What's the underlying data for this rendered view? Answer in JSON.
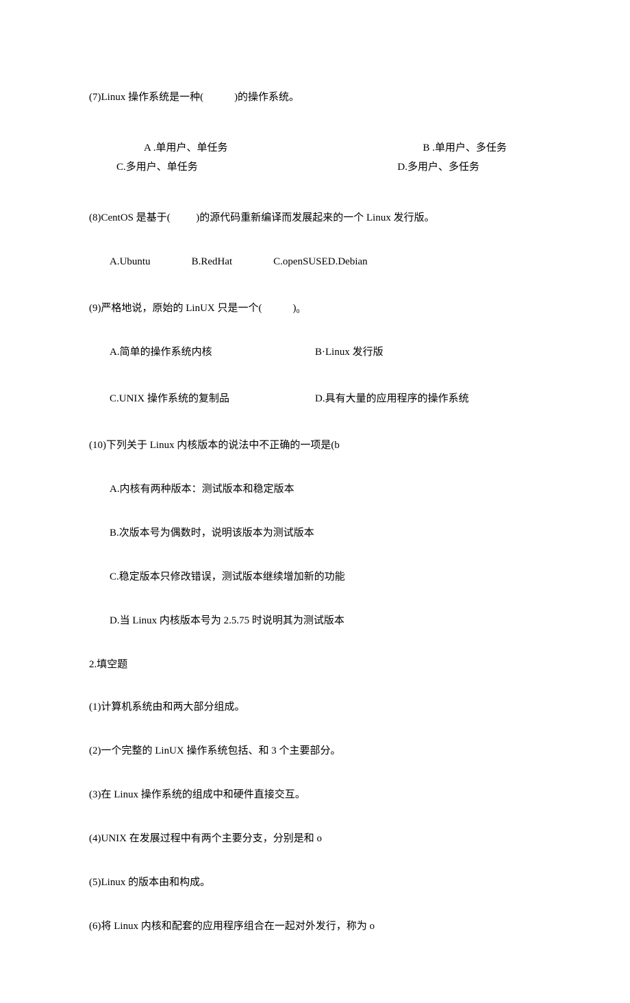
{
  "q7": {
    "stem": "(7)Linux 操作系统是一种(            )的操作系统。",
    "optA": "A .单用户、单任务",
    "optB": "B .单用户、多任务",
    "optC": "C.多用户、单任务",
    "optD": "D.多用户、多任务"
  },
  "q8": {
    "stem": "(8)CentOS 是基于(          )的源代码重新编译而发展起来的一个 Linux 发行版。",
    "optA": "A.Ubuntu",
    "optB": "B.RedHat",
    "optCD": "C.openSUSED.Debian"
  },
  "q9": {
    "stem": "(9)严格地说，原始的 LinUX 只是一个(            )₀",
    "optA": "A.简单的操作系统内核",
    "optB": "B·Linux 发行版",
    "optC": "C.UNIX 操作系统的复制品",
    "optD": "D.具有大量的应用程序的操作系统"
  },
  "q10": {
    "stem": "(10)下列关于 Linux 内核版本的说法中不正确的一项是(b",
    "optA": "A.内核有两种版本：测试版本和稳定版本",
    "optB": "B.次版本号为偶数时，说明该版本为测试版本",
    "optC": "C.稳定版本只修改错误，测试版本继续增加新的功能",
    "optD": "D.当 Linux 内核版本号为 2.5.75 时说明其为测试版本"
  },
  "section2": {
    "title": "2.填空题",
    "f1": "(1)计算机系统由和两大部分组成。",
    "f2": "(2)一个完整的 LinUX 操作系统包括、和 3 个主要部分。",
    "f3": "(3)在 Linux 操作系统的组成中和硬件直接交互。",
    "f4": "(4)UNIX 在发展过程中有两个主要分支，分别是和 o",
    "f5": "(5)Linux 的版本由和构成。",
    "f6": "(6)将 Linux 内核和配套的应用程序组合在一起对外发行，称为 o"
  }
}
